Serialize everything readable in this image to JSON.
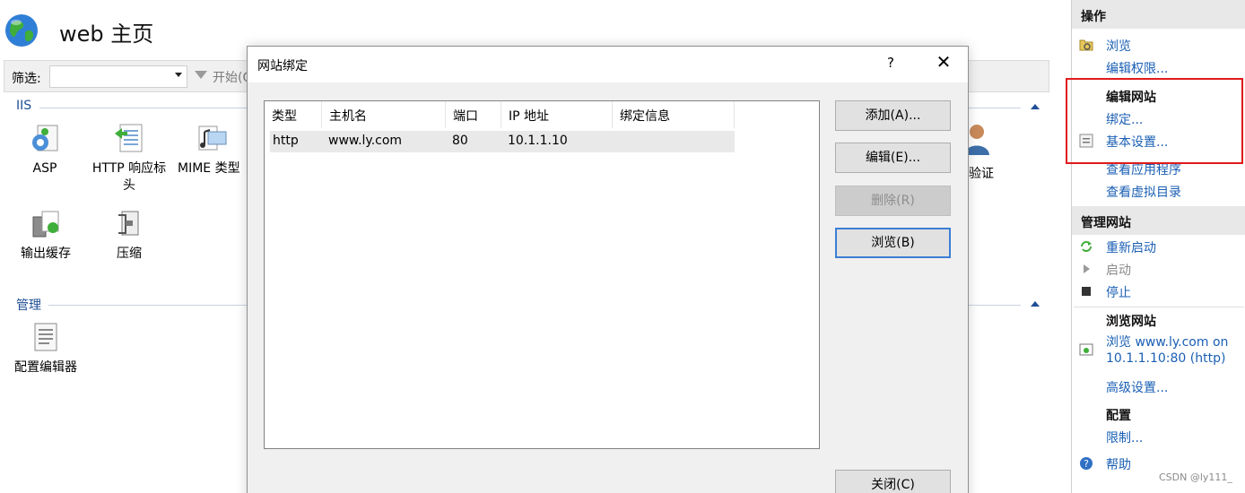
{
  "page": {
    "title": "web 主页",
    "filter_label": "筛选:",
    "filter_go": "开始(G)"
  },
  "iis": {
    "heading": "IIS",
    "features": [
      "ASP",
      "HTTP 响应标头",
      "MIME 类型",
      "输出缓存",
      "压缩"
    ],
    "partial_feature": "验证"
  },
  "manage": {
    "heading": "管理",
    "features": [
      "配置编辑器"
    ]
  },
  "dialog": {
    "title": "网站绑定",
    "help": "?",
    "close": "✕",
    "columns": [
      "类型",
      "主机名",
      "端口",
      "IP 地址",
      "绑定信息"
    ],
    "rows": [
      {
        "type": "http",
        "host": "www.ly.com",
        "port": "80",
        "ip": "10.1.1.10",
        "info": ""
      }
    ],
    "buttons": {
      "add": "添加(A)...",
      "edit": "编辑(E)...",
      "delete": "删除(R)",
      "browse": "浏览(B)",
      "close": "关闭(C)"
    }
  },
  "actions": {
    "heading": "操作",
    "browse": "浏览",
    "edit_permissions": "编辑权限...",
    "edit_site_heading": "编辑网站",
    "bindings": "绑定...",
    "basic_settings": "基本设置...",
    "view_apps": "查看应用程序",
    "view_vdirs": "查看虚拟目录",
    "manage_site_heading": "管理网站",
    "restart": "重新启动",
    "start": "启动",
    "stop": "停止",
    "browse_site_heading": "浏览网站",
    "browse_url_line1": "浏览 www.ly.com on",
    "browse_url_line2": "10.1.1.10:80 (http)",
    "advanced_settings": "高级设置...",
    "config_heading": "配置",
    "limits": "限制...",
    "help": "帮助"
  },
  "watermark": "CSDN @ly111_",
  "colors": {
    "link": "#1a5fb4",
    "highlight_box": "#e01b1b",
    "section": "#1f4e96"
  }
}
